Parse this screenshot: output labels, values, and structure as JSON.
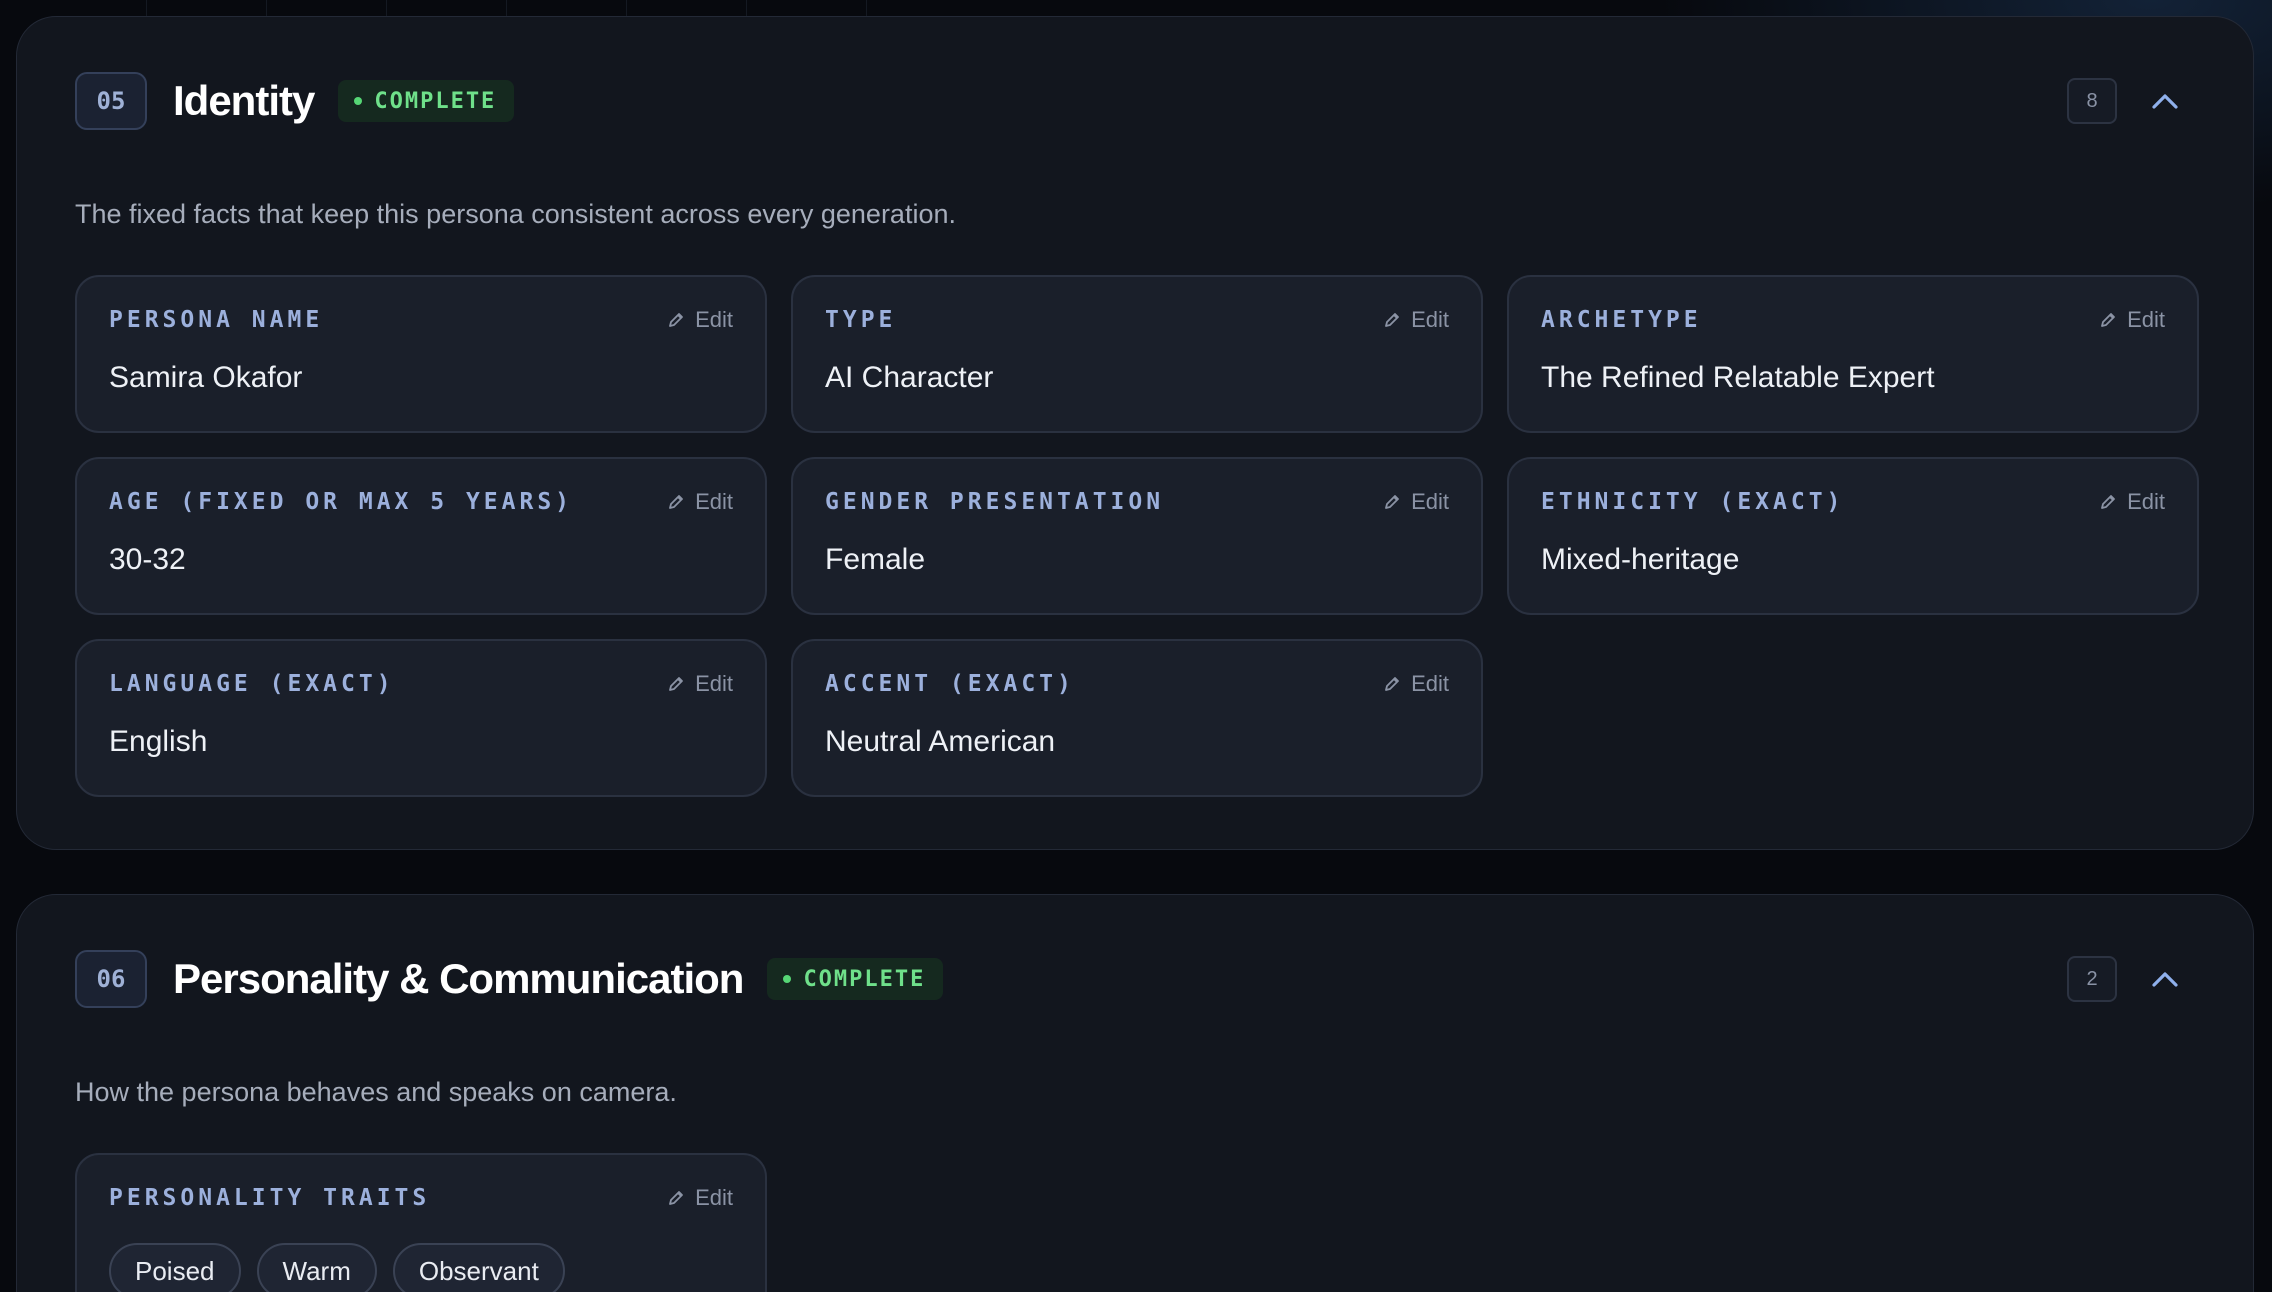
{
  "sections": [
    {
      "number": "05",
      "title": "Identity",
      "status": "COMPLETE",
      "count": "8",
      "description": "The fixed facts that keep this persona consistent across every generation.",
      "edit_label": "Edit",
      "fields": [
        {
          "label": "PERSONA NAME",
          "value": "Samira Okafor"
        },
        {
          "label": "TYPE",
          "value": "AI Character"
        },
        {
          "label": "ARCHETYPE",
          "value": "The Refined Relatable Expert"
        },
        {
          "label": "AGE (FIXED OR MAX 5 YEARS)",
          "value": "30-32"
        },
        {
          "label": "GENDER PRESENTATION",
          "value": "Female"
        },
        {
          "label": "ETHNICITY (EXACT)",
          "value": "Mixed-heritage"
        },
        {
          "label": "LANGUAGE (EXACT)",
          "value": "English"
        },
        {
          "label": "ACCENT (EXACT)",
          "value": "Neutral American"
        }
      ]
    },
    {
      "number": "06",
      "title": "Personality & Communication",
      "status": "COMPLETE",
      "count": "2",
      "description": "How the persona behaves and speaks on camera.",
      "edit_label": "Edit",
      "fields": [
        {
          "label": "PERSONALITY TRAITS",
          "chips": [
            "Poised",
            "Warm",
            "Observant"
          ]
        }
      ]
    }
  ],
  "colors": {
    "accent": "#9cb0dc",
    "status_complete": "#6fe08a",
    "background": "#07090e",
    "card": "#1a1f2a"
  },
  "icons": {
    "edit": "pencil-icon",
    "collapse": "chevron-up-icon"
  }
}
